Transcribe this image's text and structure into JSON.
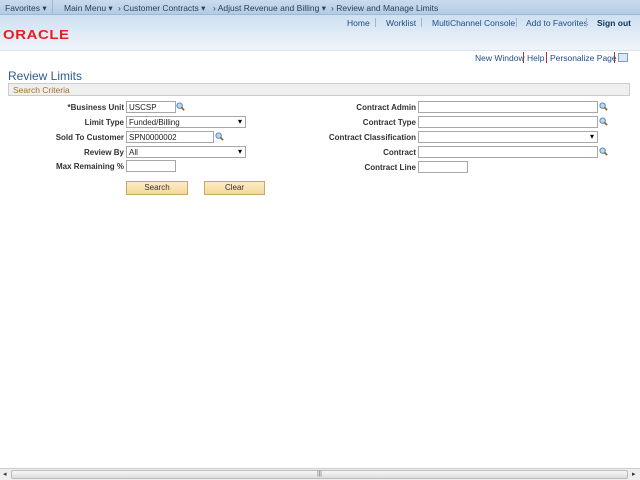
{
  "nav": {
    "favorites": "Favorites",
    "main_menu": "Main Menu",
    "crumbs": [
      "Customer Contracts",
      "Adjust Revenue and Billing",
      "Review and Manage Limits"
    ]
  },
  "header": {
    "links": [
      "Home",
      "Worklist",
      "MultiChannel Console",
      "Add to Favorites"
    ],
    "signout": "Sign out",
    "logo": "ORACLE"
  },
  "pagelinks": {
    "new_window": "New Window",
    "help": "Help",
    "personalize": "Personalize Page"
  },
  "page": {
    "title": "Review Limits",
    "section": "Search Criteria"
  },
  "left": {
    "business_unit_label": "*Business Unit",
    "business_unit": "USCSP",
    "limit_type_label": "Limit Type",
    "limit_type": "Funded/Billing",
    "sold_to_label": "Sold To Customer",
    "sold_to": "SPN0000002",
    "review_by_label": "Review By",
    "review_by": "All",
    "max_rem_label": "Max Remaining %",
    "max_rem": ""
  },
  "right": {
    "admin_label": "Contract Admin",
    "type_label": "Contract Type",
    "class_label": "Contract Classification",
    "contract_label": "Contract",
    "line_label": "Contract Line"
  },
  "buttons": {
    "search": "Search",
    "clear": "Clear"
  }
}
